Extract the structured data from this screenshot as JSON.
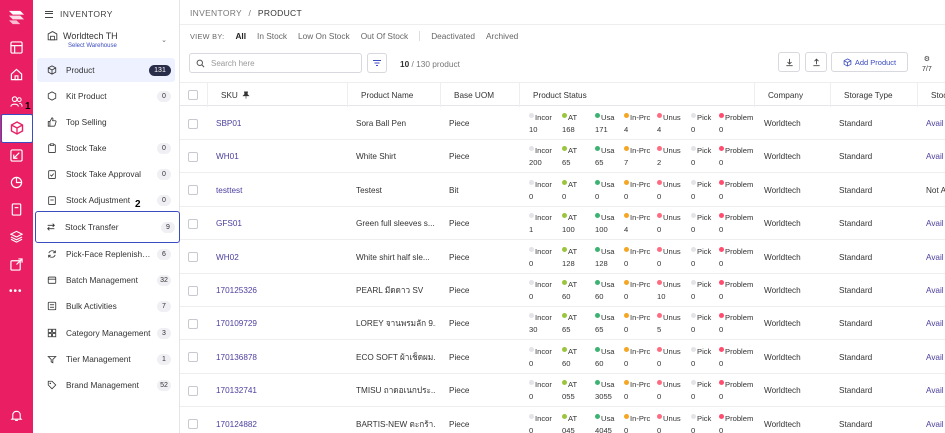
{
  "colors": {
    "rail": "#e91e63",
    "accent": "#3b4cc0",
    "link": "#4b3f9e",
    "badge_active": "#2a2d4a"
  },
  "annotations": {
    "step1": "1",
    "step2": "2"
  },
  "sidebar": {
    "title": "INVENTORY",
    "warehouse": {
      "name": "Worldtech TH",
      "action": "Select Warehouse"
    },
    "items": [
      {
        "label": "Product",
        "count": "131",
        "icon": "cube-icon"
      },
      {
        "label": "Kit Product",
        "count": "0",
        "icon": "kit-icon"
      },
      {
        "label": "Top Selling",
        "count": "",
        "icon": "thumbs-up-icon"
      },
      {
        "label": "Stock Take",
        "count": "0",
        "icon": "clipboard-icon"
      },
      {
        "label": "Stock Take Approval",
        "count": "0",
        "icon": "clipboard-check-icon"
      },
      {
        "label": "Stock Adjustment",
        "count": "0",
        "icon": "adjust-icon"
      },
      {
        "label": "Stock Transfer",
        "count": "9",
        "icon": "transfer-icon"
      },
      {
        "label": "Pick-Face Replenishment",
        "count": "6",
        "icon": "refresh-icon"
      },
      {
        "label": "Batch Management",
        "count": "32",
        "icon": "batch-icon"
      },
      {
        "label": "Bulk Activities",
        "count": "7",
        "icon": "bulk-icon"
      },
      {
        "label": "Category Management",
        "count": "3",
        "icon": "category-icon"
      },
      {
        "label": "Tier Management",
        "count": "1",
        "icon": "tier-icon"
      },
      {
        "label": "Brand Management",
        "count": "52",
        "icon": "tag-icon"
      }
    ]
  },
  "main": {
    "breadcrumb": {
      "root": "INVENTORY",
      "sep": "/",
      "current": "PRODUCT"
    },
    "viewby": {
      "label": "VIEW BY:",
      "tabs": [
        "All",
        "In Stock",
        "Low On Stock",
        "Out Of Stock",
        "Deactivated",
        "Archived"
      ],
      "active": "All"
    },
    "search": {
      "placeholder": "Search here"
    },
    "count": {
      "shown": "10",
      "total": "/ 130 product"
    },
    "add_button": "Add Product",
    "columns_toggle": "7/7",
    "headers": {
      "sku": "SKU",
      "name": "Product Name",
      "uom": "Base UOM",
      "status": "Product Status",
      "company": "Company",
      "storage": "Storage Type",
      "stock": "Stoc"
    },
    "status_labels": [
      "Incor",
      "AT",
      "Usa",
      "In-Prc",
      "Unus",
      "Pick",
      "Problem"
    ],
    "status_colors": [
      "#e3e3e8",
      "#9bc53d",
      "#3cb371",
      "#f5a623",
      "#ff6b81",
      "#e3e3e8",
      "#ff4d6d"
    ],
    "rows": [
      {
        "sku": "SBP01",
        "name": "Sora Ball Pen",
        "uom": "Piece",
        "status": [
          "10",
          "168",
          "171",
          "4",
          "4",
          "0",
          "0"
        ],
        "company": "Worldtech",
        "storage": "Standard",
        "stock": "Avail"
      },
      {
        "sku": "WH01",
        "name": "White Shirt",
        "uom": "Piece",
        "status": [
          "200",
          "65",
          "65",
          "7",
          "2",
          "0",
          "0"
        ],
        "company": "Worldtech",
        "storage": "Standard",
        "stock": "Avail"
      },
      {
        "sku": "testtest",
        "name": "Testest",
        "uom": "Bit",
        "status": [
          "0",
          "0",
          "0",
          "0",
          "0",
          "0",
          "0"
        ],
        "company": "Worldtech",
        "storage": "Standard",
        "stock": "Not A"
      },
      {
        "sku": "GFS01",
        "name": "Green full sleeves s...",
        "uom": "Piece",
        "status": [
          "1",
          "100",
          "100",
          "4",
          "0",
          "0",
          "0"
        ],
        "company": "Worldtech",
        "storage": "Standard",
        "stock": "Avail"
      },
      {
        "sku": "WH02",
        "name": "White shirt half sle...",
        "uom": "Piece",
        "status": [
          "0",
          "128",
          "128",
          "0",
          "0",
          "0",
          "0"
        ],
        "company": "Worldtech",
        "storage": "Standard",
        "stock": "Avail"
      },
      {
        "sku": "170125326",
        "name": "PEARL มีดดาว SV",
        "uom": "Piece",
        "status": [
          "0",
          "60",
          "60",
          "0",
          "10",
          "0",
          "0"
        ],
        "company": "Worldtech",
        "storage": "Standard",
        "stock": "Avail"
      },
      {
        "sku": "170109729",
        "name": "LOREY จานพรมลัก 9....",
        "uom": "Piece",
        "status": [
          "30",
          "65",
          "65",
          "0",
          "5",
          "0",
          "0"
        ],
        "company": "Worldtech",
        "storage": "Standard",
        "stock": "Avail"
      },
      {
        "sku": "170136878",
        "name": "ECO SOFT ผ้าเช็ดผม...",
        "uom": "Piece",
        "status": [
          "0",
          "60",
          "60",
          "0",
          "0",
          "0",
          "0"
        ],
        "company": "Worldtech",
        "storage": "Standard",
        "stock": "Avail"
      },
      {
        "sku": "170132741",
        "name": "TMISU ถาดอเนกประ...",
        "uom": "Piece",
        "status": [
          "0",
          "055",
          "3055",
          "0",
          "0",
          "0",
          "0"
        ],
        "company": "Worldtech",
        "storage": "Standard",
        "stock": "Avail"
      },
      {
        "sku": "170124882",
        "name": "BARTIS-NEW ตะกร้า...",
        "uom": "Piece",
        "status": [
          "0",
          "045",
          "4045",
          "0",
          "0",
          "0",
          "0"
        ],
        "company": "Worldtech",
        "storage": "Standard",
        "stock": "Avail"
      }
    ]
  }
}
